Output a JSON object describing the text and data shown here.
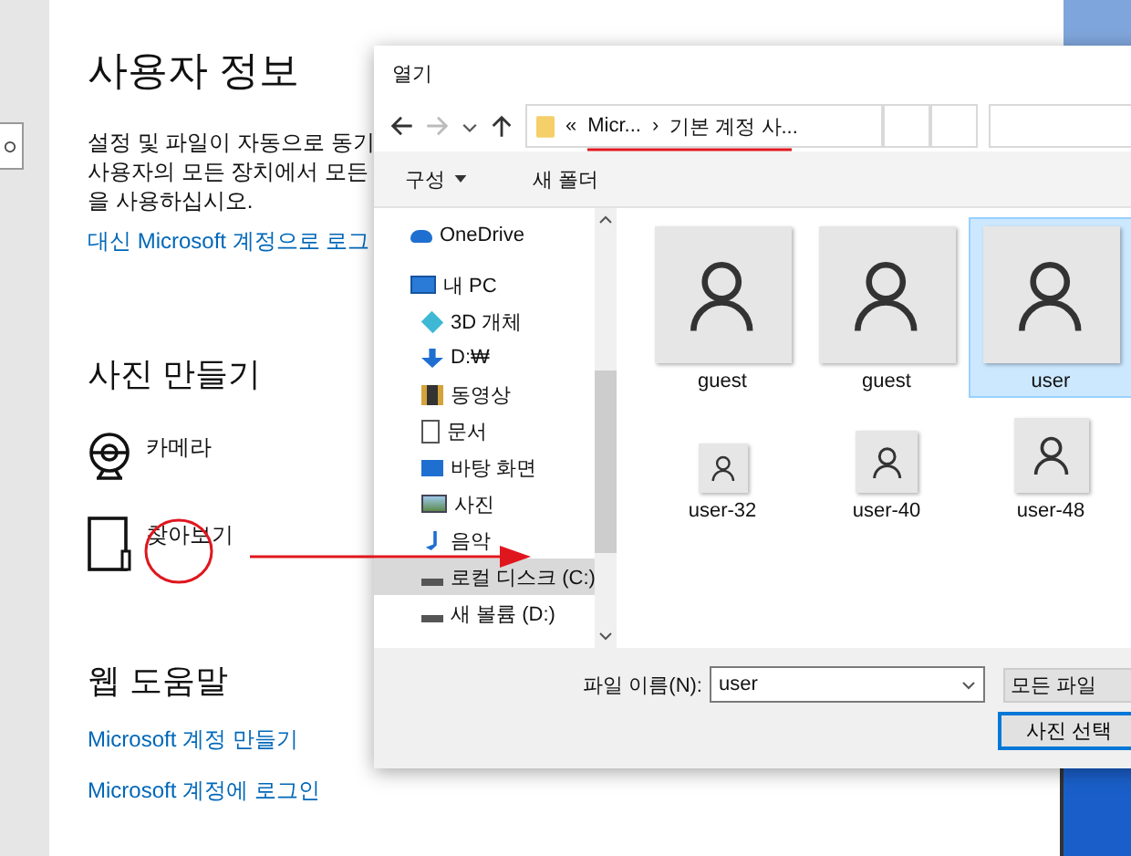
{
  "settings": {
    "title": "사용자 정보",
    "description_lines": [
      "설정 및 파일이 자동으로 동기",
      "사용자의 모든 장치에서 모든",
      "을 사용하십시오."
    ],
    "link": "대신 Microsoft 계정으로 로그",
    "photo_section": {
      "title": "사진 만들기",
      "options": [
        {
          "kind": "camera",
          "label": "카메라"
        },
        {
          "kind": "browse",
          "label": "찾아보기"
        }
      ]
    },
    "help": {
      "title": "웹 도움말",
      "links": [
        "Microsoft 계정 만들기",
        "Microsoft 계정에 로그인"
      ]
    }
  },
  "dialog": {
    "title": "열기",
    "breadcrumb": {
      "overflow": "«",
      "separator": "›",
      "segments": [
        "Micr...",
        "기본 계정 사..."
      ]
    },
    "toolbar": [
      {
        "label": "구성",
        "dropdown": true
      },
      {
        "label": "새 폴더",
        "dropdown": false
      }
    ],
    "nav": [
      {
        "label": "OneDrive",
        "selected": false
      },
      {
        "label": "내 PC",
        "selected": false,
        "children": [
          {
            "label": "3D 개체",
            "selected": false
          },
          {
            "label": "D:₩",
            "selected": false
          },
          {
            "label": "동영상",
            "selected": false
          },
          {
            "label": "문서",
            "selected": false
          },
          {
            "label": "바탕 화면",
            "selected": false
          },
          {
            "label": "사진",
            "selected": false
          },
          {
            "label": "음악",
            "selected": false
          },
          {
            "label": "로컬 디스크 (C:)",
            "selected": true
          },
          {
            "label": "새 볼륨 (D:)",
            "selected": false
          }
        ]
      }
    ],
    "files": [
      {
        "kind": "large",
        "name": "guest",
        "selected": false
      },
      {
        "kind": "large",
        "name": "guest",
        "selected": false
      },
      {
        "kind": "large",
        "name": "user",
        "selected": true
      },
      {
        "kind": "s32",
        "name": "user-32",
        "selected": false
      },
      {
        "kind": "s40",
        "name": "user-40",
        "selected": false
      },
      {
        "kind": "s48",
        "name": "user-48",
        "selected": false
      }
    ],
    "filename_label": "파일 이름(N):",
    "filename": "user",
    "filetype": "모든 파일",
    "open_button": "사진 선택"
  }
}
